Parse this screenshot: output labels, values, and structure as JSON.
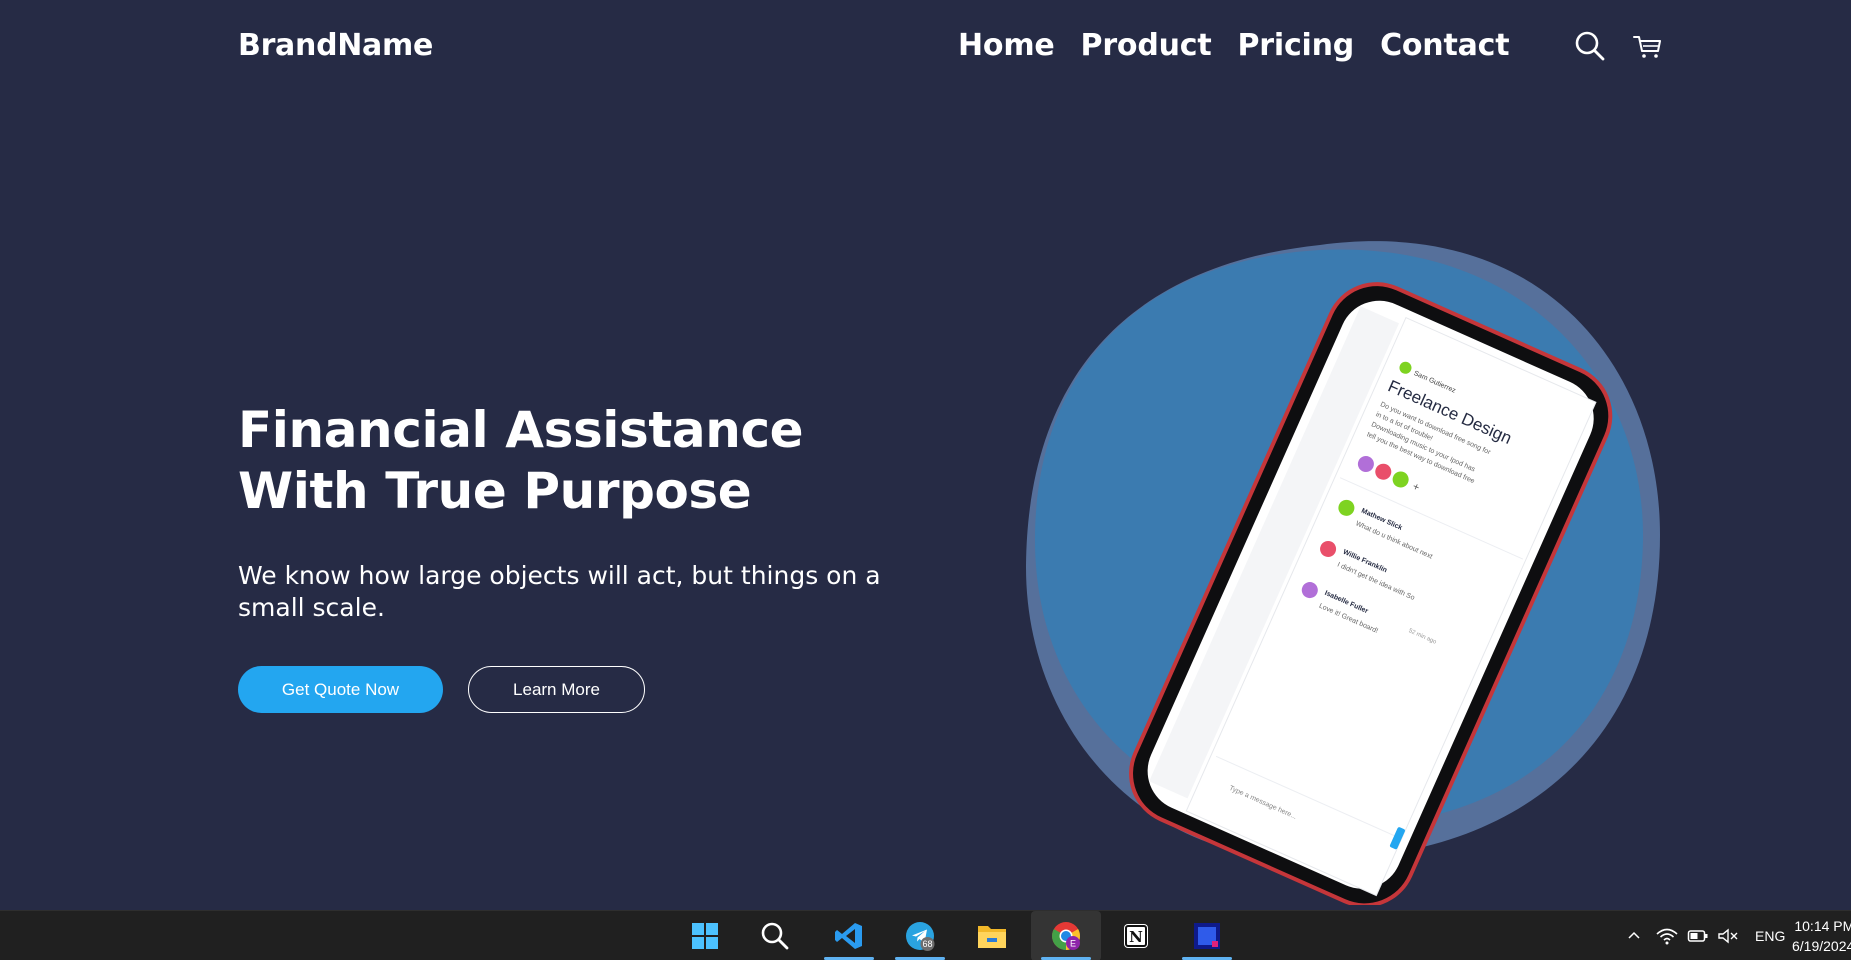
{
  "header": {
    "brand": "BrandName",
    "nav": [
      "Home",
      "Product",
      "Pricing",
      "Contact"
    ]
  },
  "hero": {
    "headline_line1": "Financial Assistance",
    "headline_line2": "With True Purpose",
    "subtext_line1": "We know how large objects will act, but things on a",
    "subtext_line2": "small scale.",
    "primary_button": "Get Quote Now",
    "secondary_button": "Learn More"
  },
  "phone_screen": {
    "author": "Sam Gutierrez",
    "title": "Freelance Design",
    "body_lines": [
      "Do you want to download free song for",
      "in to a lot of trouble!",
      "Downloading music to your Ipod has",
      "tell you the best way to download free"
    ],
    "comments": [
      {
        "name": "Mathew Slick",
        "text": "What do u think about next"
      },
      {
        "name": "Willie Franklin",
        "text": "I didn't get the idea with So"
      },
      {
        "name": "Isabelle Fuller",
        "time": "52 min ago",
        "text": "Love it! Great board!"
      }
    ],
    "input_placeholder": "Type a message here..."
  },
  "taskbar": {
    "apps": [
      "start-icon",
      "search-icon",
      "vscode-icon",
      "telegram-icon",
      "file-explorer-icon",
      "chrome-icon",
      "notion-icon",
      "app-icon"
    ],
    "telegram_badge": "68",
    "language": "ENG",
    "time": "10:14 PM",
    "date": "6/19/2024"
  },
  "colors": {
    "background": "#262b45",
    "accent": "#23a6f0",
    "circle": "#3b7bb0",
    "phone_frame": "#c5363a"
  }
}
